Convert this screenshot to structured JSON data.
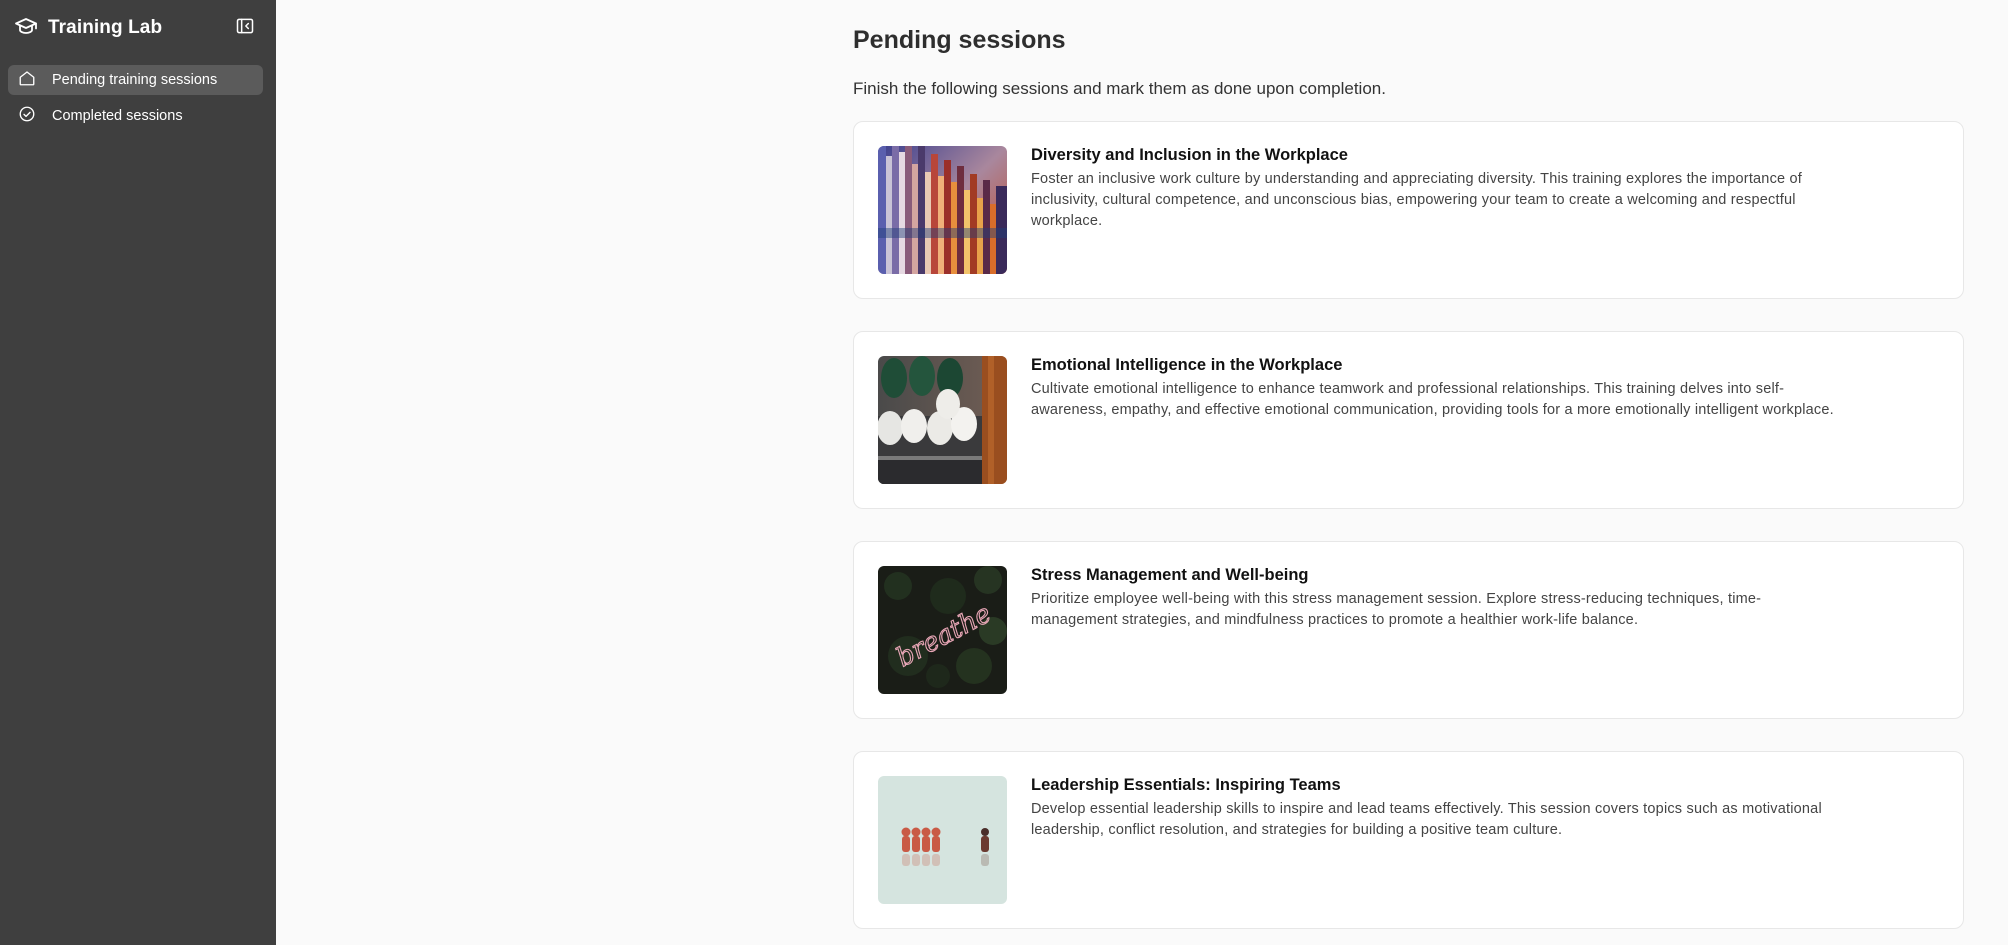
{
  "app": {
    "title": "Training Lab"
  },
  "sidebar": {
    "items": [
      {
        "label": "Pending training sessions",
        "icon": "home-icon",
        "active": true
      },
      {
        "label": "Completed sessions",
        "icon": "check-circle-icon",
        "active": false
      }
    ]
  },
  "main": {
    "title": "Pending sessions",
    "subtitle": "Finish the following sessions and mark them as done upon completion.",
    "sessions": [
      {
        "title": "Diversity and Inclusion in the Workplace",
        "description": "Foster an inclusive work culture by understanding and appreciating diversity. This training explores the importance of inclusivity, cultural competence, and unconscious bias, empowering your team to create a welcoming and respectful workplace."
      },
      {
        "title": "Emotional Intelligence in the Workplace",
        "description": "Cultivate emotional intelligence to enhance teamwork and professional relationships. This training delves into self-awareness, empathy, and effective emotional communication, providing tools for a more emotionally intelligent workplace."
      },
      {
        "title": "Stress Management and Well-being",
        "description": "Prioritize employee well-being with this stress management session. Explore stress-reducing techniques, time-management strategies, and mindfulness practices to promote a healthier work-life balance."
      },
      {
        "title": "Leadership Essentials: Inspiring Teams",
        "description": "Develop essential leadership skills to inspire and lead teams effectively. This session covers topics such as motivational leadership, conflict resolution, and strategies for building a positive team culture."
      }
    ]
  },
  "thumbnails": {
    "s1": {
      "text": ""
    },
    "s3": {
      "neon_text": "breathe"
    }
  },
  "colors": {
    "sidebar_bg": "#3f3f3f",
    "sidebar_active": "#5b5b5b",
    "page_bg": "#fafafa",
    "card_border": "#e7e7e7"
  }
}
